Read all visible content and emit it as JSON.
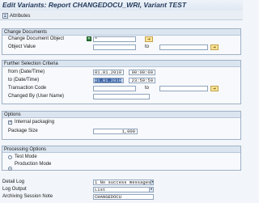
{
  "title": "Edit Variants: Report CHANGEDOCU_WRI, Variant TEST",
  "toolbar": {
    "attributes_label": "Attributes"
  },
  "change_documents": {
    "header": "Change Documents",
    "change_document_object_label": "Change Document Object",
    "change_document_object_value": "*",
    "object_value_label": "Object Value",
    "to_label": "to"
  },
  "further_selection": {
    "header": "Further Selection Criteria",
    "from_label": "from (Date/Time)",
    "from_date": "01.01.2010",
    "from_time": "00:00:00",
    "to_label": "to (Date/Time)",
    "to_date": "01.01.2010",
    "to_time": "23:59:59",
    "transaction_code_label": "Transaction Code",
    "transaction_to_label": "to",
    "changed_by_label": "Changed By (User Name)"
  },
  "options": {
    "header": "Options",
    "internal_packaging_label": "Internal packaging",
    "internal_packaging_checked": true,
    "package_size_label": "Package Size",
    "package_size_value": "1,000"
  },
  "processing_options": {
    "header": "Processing Options",
    "test_mode_label": "Test Mode",
    "production_mode_label": "Production Mode",
    "selected": "Production Mode"
  },
  "bottom": {
    "detail_log_label": "Detail Log",
    "detail_log_value": "1 No success messages",
    "log_output_label": "Log Output",
    "log_output_value": "List",
    "archiving_note_label": "Archiving Session Note",
    "archiving_note_value": "CHANGEDOCU"
  }
}
